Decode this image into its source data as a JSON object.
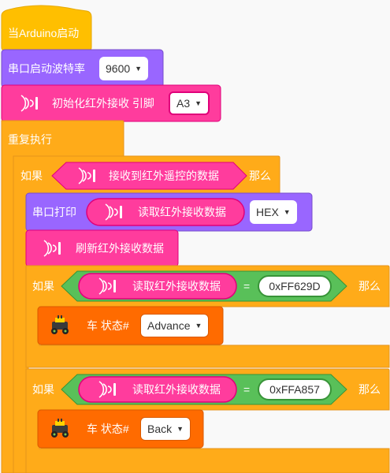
{
  "colors": {
    "event": "#ffbf00",
    "control": "#ffab19",
    "serial": "#9966ff",
    "ir": "#ff3c9d",
    "ir_dark": "#e0007a",
    "operator": "#59c059",
    "car": "#ff6b00",
    "white": "#ffffff"
  },
  "event_block": {
    "label": "当Arduino启动"
  },
  "serial_begin": {
    "label": "串口启动波特率",
    "baud": "9600"
  },
  "ir_init": {
    "icon": "ir-receiver-icon",
    "label": "初始化红外接收 引脚",
    "pin": "A3"
  },
  "forever": {
    "label": "重复执行"
  },
  "if_outer": {
    "if_label": "如果",
    "condition": "接收到红外遥控的数据",
    "then_label": "那么"
  },
  "serial_print": {
    "label": "串口打印",
    "reporter": "读取红外接收数据",
    "format": "HEX"
  },
  "ir_refresh": {
    "label": "刷新红外接收数据"
  },
  "if_advance": {
    "if_label": "如果",
    "reporter": "读取红外接收数据",
    "operator": "=",
    "value": "0xFF629D",
    "then_label": "那么"
  },
  "car_advance": {
    "icon": "robot-car-icon",
    "label": "车 状态#",
    "state": "Advance"
  },
  "if_back": {
    "if_label": "如果",
    "reporter": "读取红外接收数据",
    "operator": "=",
    "value": "0xFFA857",
    "then_label": "那么"
  },
  "car_back": {
    "icon": "robot-car-icon",
    "label": "车 状态#",
    "state": "Back"
  }
}
